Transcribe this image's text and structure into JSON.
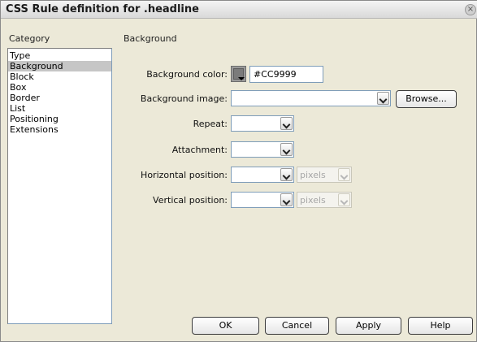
{
  "window": {
    "title": "CSS Rule definition for .headline",
    "close_glyph": "×"
  },
  "category": {
    "label": "Category",
    "items": [
      "Type",
      "Background",
      "Block",
      "Box",
      "Border",
      "List",
      "Positioning",
      "Extensions"
    ],
    "selected": "Background"
  },
  "section": {
    "title": "Background"
  },
  "fields": {
    "bg_color_label": "Background color:",
    "bg_color_value": "#CC9999",
    "bg_image_label": "Background image:",
    "bg_image_value": "",
    "browse_label": "Browse...",
    "repeat_label": "Repeat:",
    "repeat_value": "",
    "attachment_label": "Attachment:",
    "attachment_value": "",
    "hpos_label": "Horizontal position:",
    "hpos_value": "",
    "hpos_unit": "pixels",
    "vpos_label": "Vertical position:",
    "vpos_value": "",
    "vpos_unit": "pixels"
  },
  "buttons": {
    "ok": "OK",
    "cancel": "Cancel",
    "apply": "Apply",
    "help": "Help"
  },
  "colors": {
    "dialog_bg": "#ece9d8",
    "selection": "#c6c6c6",
    "input_border": "#7f9db9"
  }
}
